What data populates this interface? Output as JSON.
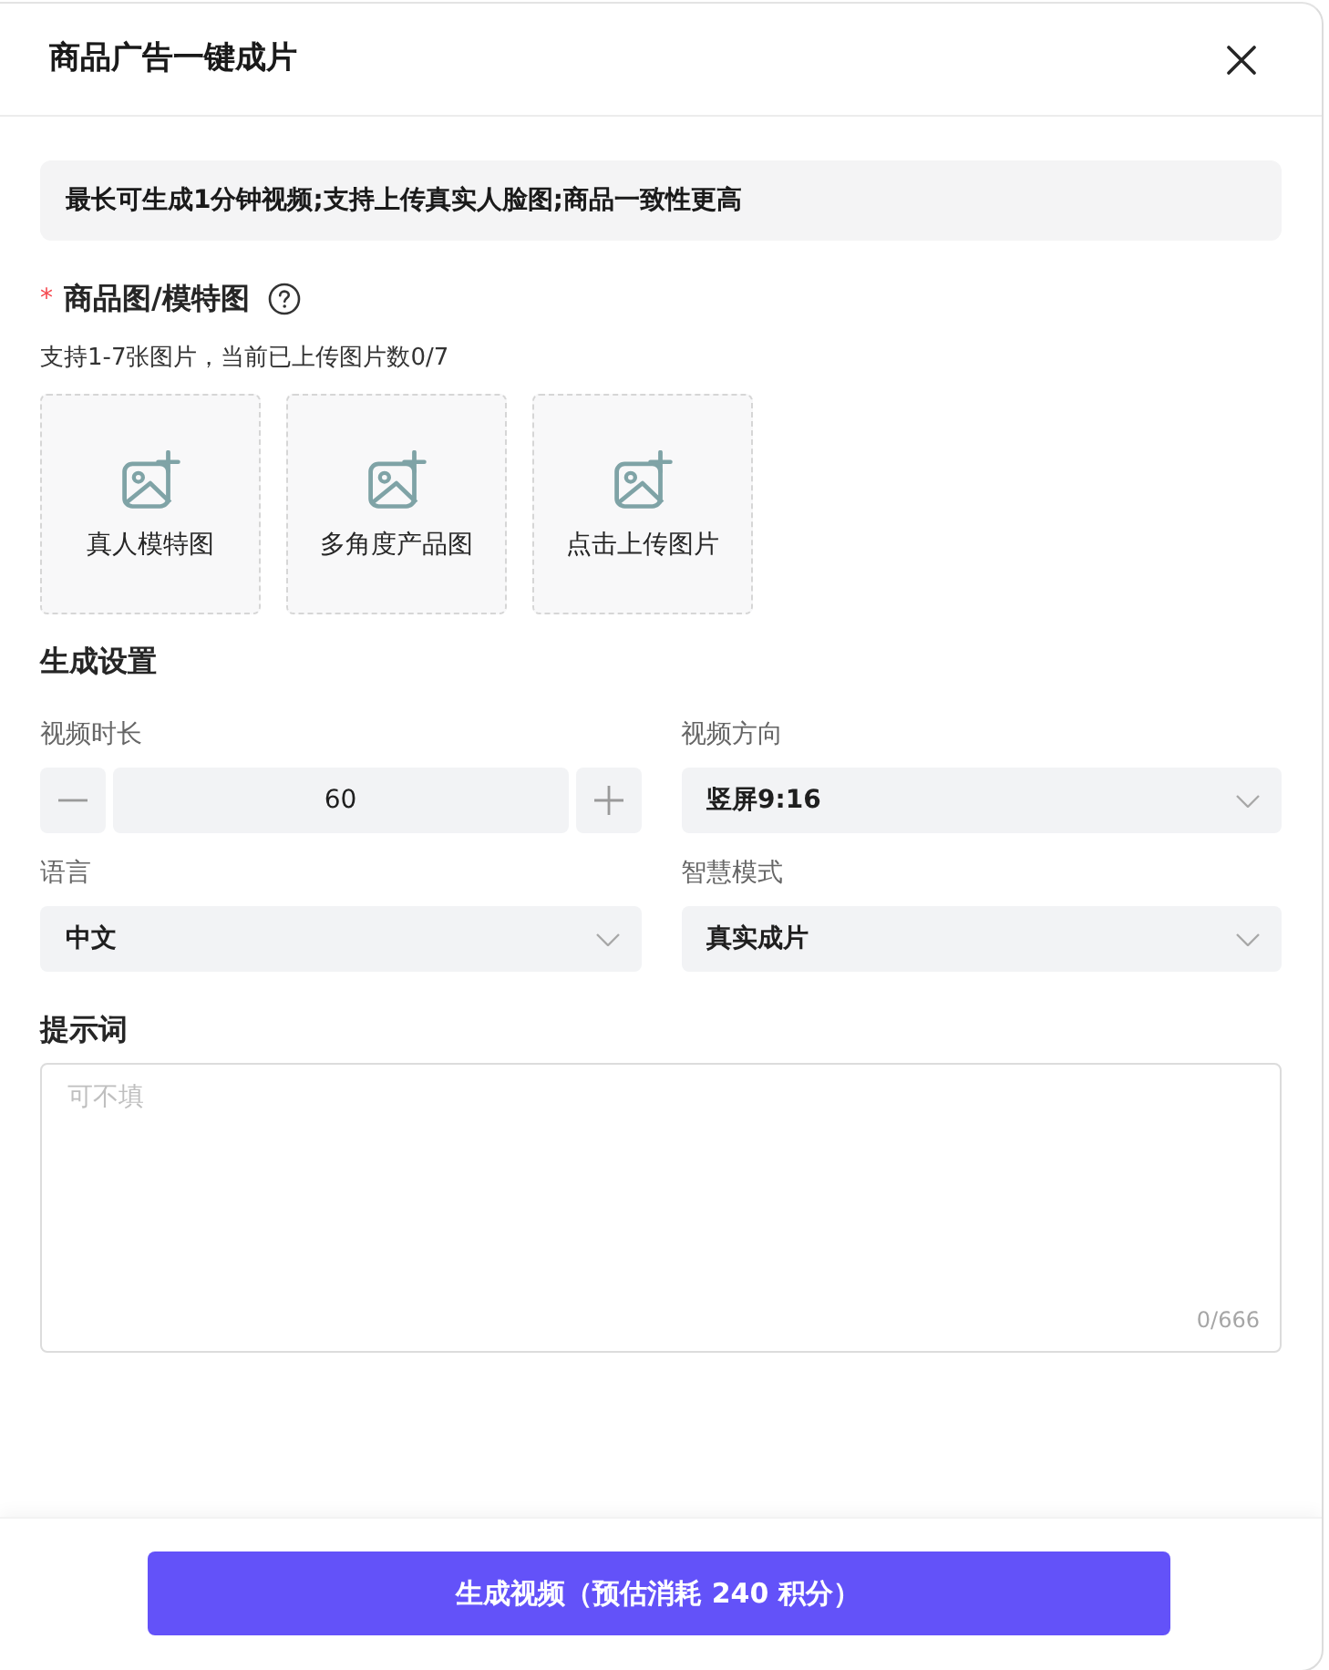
{
  "dialog": {
    "title": "商品广告一键成片"
  },
  "notice": "最长可生成1分钟视频;支持上传真实人脸图;商品一致性更高",
  "upload": {
    "required_mark": "*",
    "label": "商品图/模特图",
    "hint": "支持1-7张图片，当前已上传图片数0/7",
    "tiles": [
      {
        "label": "真人模特图"
      },
      {
        "label": "多角度产品图"
      },
      {
        "label": "点击上传图片"
      }
    ]
  },
  "settings": {
    "title": "生成设置",
    "fields": [
      {
        "kind": "stepper",
        "label": "视频时长",
        "value": "60"
      },
      {
        "kind": "select",
        "label": "视频方向",
        "value": "竖屏9:16"
      },
      {
        "kind": "select",
        "label": "语言",
        "value": "中文"
      },
      {
        "kind": "select",
        "label": "智慧模式",
        "value": "真实成片"
      }
    ]
  },
  "prompt": {
    "label": "提示词",
    "placeholder": "可不填",
    "counter": "0/666"
  },
  "submit": {
    "label": "生成视频（预估消耗 240 积分）"
  }
}
